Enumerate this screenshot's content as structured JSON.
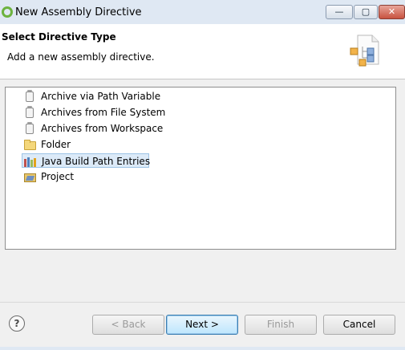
{
  "window": {
    "title": "New Assembly Directive"
  },
  "title_bar_buttons": {
    "minimize_glyph": "—",
    "maximize_glyph": "▢",
    "close_glyph": "✕"
  },
  "header": {
    "title": "Select Directive Type",
    "description": "Add a new assembly directive."
  },
  "tree": {
    "items": [
      {
        "label": "Archive via Path Variable",
        "icon": "jar-icon",
        "selected": false
      },
      {
        "label": "Archives from File System",
        "icon": "jar-icon",
        "selected": false
      },
      {
        "label": "Archives from Workspace",
        "icon": "jar-icon",
        "selected": false
      },
      {
        "label": "Folder",
        "icon": "folder-icon",
        "selected": false
      },
      {
        "label": "Java Build Path Entries",
        "icon": "library-icon",
        "selected": true
      },
      {
        "label": "Project",
        "icon": "project-icon",
        "selected": false
      }
    ]
  },
  "footer": {
    "help_glyph": "?",
    "back_label": "< Back",
    "next_label": "Next >",
    "finish_label": "Finish",
    "cancel_label": "Cancel"
  },
  "colors": {
    "selection_background": "#dceaf8",
    "titlebar": "#dfe8f3",
    "dialog_background": "#f0f0f0"
  }
}
